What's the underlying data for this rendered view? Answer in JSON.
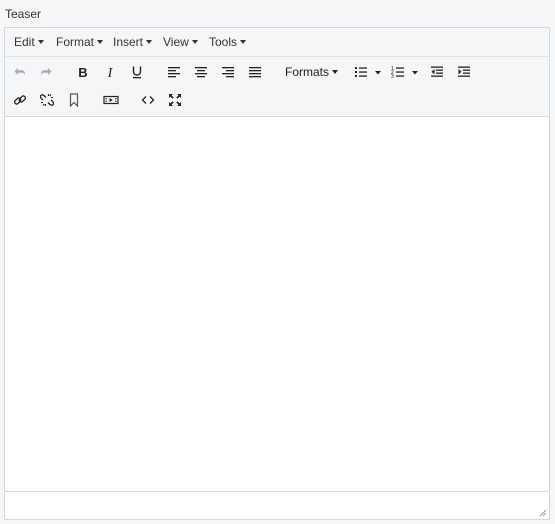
{
  "field": {
    "label": "Teaser"
  },
  "menubar": {
    "items": [
      {
        "label": "Edit"
      },
      {
        "label": "Format"
      },
      {
        "label": "Insert"
      },
      {
        "label": "View"
      },
      {
        "label": "Tools"
      }
    ]
  },
  "toolbar": {
    "formats_label": "Formats",
    "icons": [
      "undo-icon",
      "redo-icon",
      "bold-icon",
      "italic-icon",
      "underline-icon",
      "align-left-icon",
      "align-center-icon",
      "align-right-icon",
      "align-justify-icon",
      "bullet-list-icon",
      "numbered-list-icon",
      "outdent-icon",
      "indent-icon",
      "link-icon",
      "unlink-icon",
      "bookmark-icon",
      "media-icon",
      "code-icon",
      "fullscreen-icon"
    ]
  },
  "content": {
    "text": ""
  },
  "colors": {
    "border": "#d4d7dc",
    "toolbar_bg": "#f5f6f8",
    "icon": "#222222",
    "icon_disabled": "#a8abb0"
  }
}
